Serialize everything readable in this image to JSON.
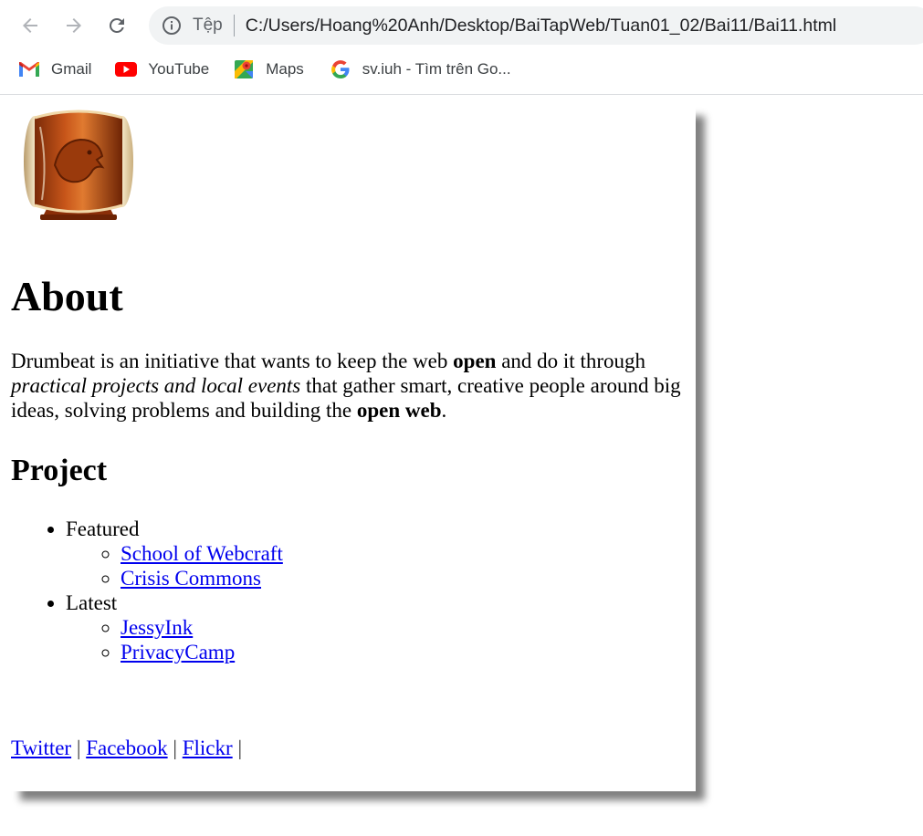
{
  "browser": {
    "scheme_label": "Tệp",
    "url": "C:/Users/Hoang%20Anh/Desktop/BaiTapWeb/Tuan01_02/Bai11/Bai11.html",
    "bookmarks": [
      {
        "label": "Gmail",
        "icon": "gmail-icon"
      },
      {
        "label": "YouTube",
        "icon": "youtube-icon"
      },
      {
        "label": "Maps",
        "icon": "maps-icon"
      },
      {
        "label": "sv.iuh - Tìm trên Go...",
        "icon": "google-icon"
      }
    ]
  },
  "page": {
    "logo": "drumbeat-drum-logo",
    "about_heading": "About",
    "intro": {
      "t1": "Drumbeat is an initiative that wants to keep the web ",
      "b1": "open",
      "t2": " and do it through ",
      "i1": "practical projects and local events",
      "t3": " that gather smart, creative people around big ideas, solving problems and building the ",
      "b2": "open web",
      "t4": "."
    },
    "project_heading": "Project",
    "groups": [
      {
        "label": "Featured",
        "links": [
          "School of Webcraft",
          "Crisis Commons"
        ]
      },
      {
        "label": "Latest",
        "links": [
          "JessyInk",
          "PrivacyCamp"
        ]
      }
    ],
    "footer": {
      "links": [
        "Twitter",
        "Facebook",
        "Flickr"
      ],
      "separator": "|"
    }
  },
  "colors": {
    "link": "#0000ee",
    "shadow": "#808080",
    "toolbar_bg": "#f1f3f4"
  }
}
